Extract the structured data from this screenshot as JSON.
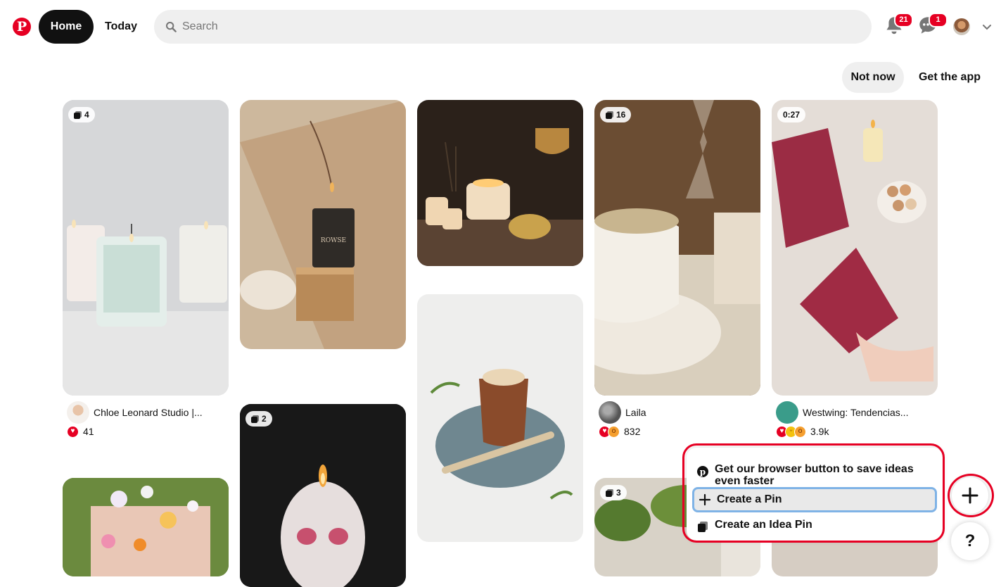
{
  "header": {
    "logo": "P",
    "home_label": "Home",
    "today_label": "Today",
    "search_placeholder": "Search",
    "notifications_count": "21",
    "messages_count": "1"
  },
  "app_banner": {
    "not_now": "Not now",
    "get_app": "Get the app"
  },
  "pins": [
    {
      "badge": "4",
      "author": "Chloe Leonard Studio |...",
      "reactions": [
        "heart"
      ],
      "count": "41"
    },
    {
      "badge": "",
      "author": "",
      "count": ""
    },
    {
      "badge": "",
      "author": "",
      "count": ""
    },
    {
      "badge": "16",
      "author": "Laila",
      "reactions": [
        "heart",
        "wow"
      ],
      "count": "832"
    },
    {
      "badge": "0:27",
      "author": "Westwing: Tendencias...",
      "reactions": [
        "heart",
        "laugh",
        "wow"
      ],
      "count": "3.9k"
    },
    {
      "badge": "2"
    },
    {
      "badge": "3"
    }
  ],
  "create_menu": {
    "browser_button": "Get our browser button to save ideas even faster",
    "create_pin": "Create a Pin",
    "create_idea_pin": "Create an Idea Pin"
  },
  "fab": {
    "plus": "+",
    "help": "?"
  },
  "colors": {
    "brand": "#e60023",
    "highlight_ring": "#e60023",
    "focus": "#7fb3e6"
  }
}
